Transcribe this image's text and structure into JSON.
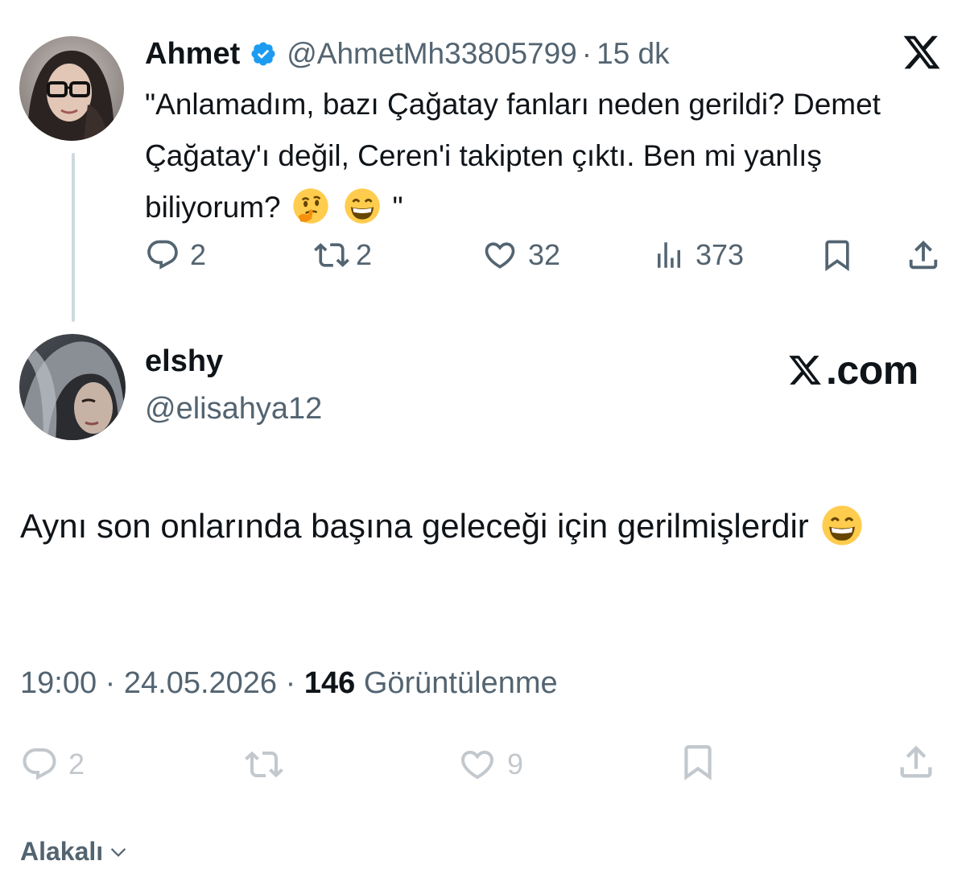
{
  "parent_tweet": {
    "display_name": "Ahmet",
    "handle": "@AhmetMh33805799",
    "separator": "·",
    "time_ago": "15 dk",
    "text": "\"Anlamadım, bazı Çağatay fanları neden gerildi? Demet Çağatay'ı değil, Ceren'i takipten çıktı. Ben mi yanlış biliyorum?",
    "text_end": "\"",
    "emojis": [
      "thinking-face",
      "grinning-face-with-smiling-eyes"
    ],
    "actions": {
      "replies": "2",
      "retweets": "2",
      "likes": "32",
      "views": "373"
    }
  },
  "reply_tweet": {
    "display_name": "elshy",
    "handle": "@elisahya12",
    "brand": "X.com",
    "brand_suffix": ".com",
    "text": "Aynı son onlarında başına geleceği için gerilmişlerdir",
    "emoji": "grinning-face-with-smiling-eyes",
    "time": "19:00",
    "date": "24.05.2026",
    "separator": "·",
    "views_count": "146",
    "views_label": "Görüntülenme",
    "actions": {
      "replies": "2",
      "likes": "9"
    }
  },
  "related": {
    "label": "Alakalı"
  },
  "colors": {
    "text": "#0f1419",
    "secondary": "#536471",
    "verified": "#1d9bf0",
    "thread_line": "#cfd9de"
  }
}
